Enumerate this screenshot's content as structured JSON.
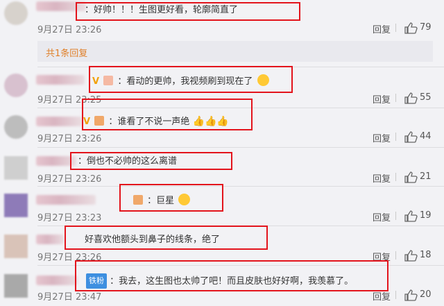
{
  "reply_label": "回复",
  "sub_replies_label": "共1条回复",
  "comments": [
    {
      "text": "：好帅！！！生图更好看，轮廓简直了",
      "time": "9月27日 23:26",
      "likes": "79"
    },
    {
      "text": "：看动的更帅，我视频刷到现在了",
      "time": "9月27日 23:25",
      "likes": "55"
    },
    {
      "text": "：谁看了不说一声绝",
      "time": "9月27日 23:26",
      "likes": "44"
    },
    {
      "text": "：倒也不必帅的这么离谱",
      "time": "9月27日 23:26",
      "likes": "21"
    },
    {
      "text": "：巨星",
      "time": "9月27日 23:23",
      "likes": "19"
    },
    {
      "text": "好喜欢他额头到鼻子的线条，绝了",
      "time": "9月27日 23:26",
      "likes": "18"
    },
    {
      "text": "：我去，这生图也太帅了吧！而且皮肤也好好啊，我羡慕了。",
      "time": "9月27日 23:47",
      "likes": "20",
      "badge": "铁粉"
    }
  ],
  "colors": {
    "highlight_box": "#e3141c",
    "accent": "#e0802a",
    "vip_badge": "#f2a20b",
    "fan_badge": "#3d8fe0"
  }
}
